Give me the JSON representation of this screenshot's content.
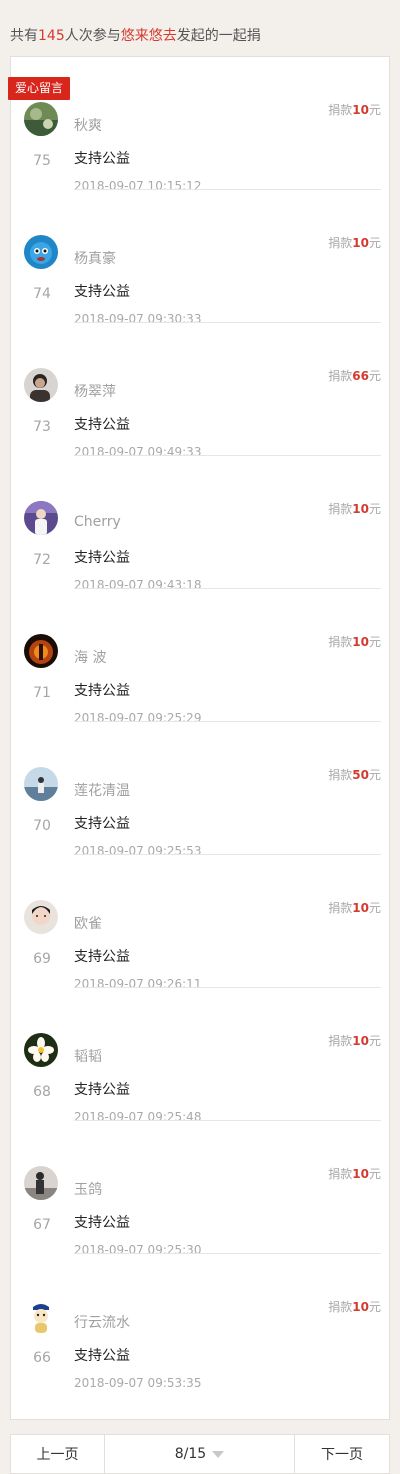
{
  "header": {
    "prefix": "共有",
    "count": "145",
    "middle": "人次参与",
    "initiator": "悠来悠去",
    "suffix": "发起的一起捐"
  },
  "badge": "爱心留言",
  "donation_prefix": "捐款",
  "currency_unit": "元",
  "accent_color": "#d53a2f",
  "items": [
    {
      "rank": "75",
      "name": "秋爽",
      "message": "支持公益",
      "time": "2018-09-07 10:15:12",
      "amount": "10",
      "avatar_icon": "lotus-pond-avatar-icon"
    },
    {
      "rank": "74",
      "name": "杨真豪",
      "message": "支持公益",
      "time": "2018-09-07 09:30:33",
      "amount": "10",
      "avatar_icon": "blue-cartoon-avatar-icon"
    },
    {
      "rank": "73",
      "name": "杨翠萍",
      "message": "支持公益",
      "time": "2018-09-07 09:49:33",
      "amount": "66",
      "avatar_icon": "person-portrait-avatar-icon"
    },
    {
      "rank": "72",
      "name": "Cherry",
      "message": "支持公益",
      "time": "2018-09-07 09:43:18",
      "amount": "10",
      "avatar_icon": "child-portrait-avatar-icon"
    },
    {
      "rank": "71",
      "name": "海 波",
      "message": "支持公益",
      "time": "2018-09-07 09:25:29",
      "amount": "10",
      "avatar_icon": "fire-figure-avatar-icon"
    },
    {
      "rank": "70",
      "name": "莲花清温",
      "message": "支持公益",
      "time": "2018-09-07 09:25:53",
      "amount": "50",
      "avatar_icon": "lakeside-person-avatar-icon"
    },
    {
      "rank": "69",
      "name": "欧雀",
      "message": "支持公益",
      "time": "2018-09-07 09:26:11",
      "amount": "10",
      "avatar_icon": "woman-portrait-avatar-icon"
    },
    {
      "rank": "68",
      "name": "韬韬",
      "message": "支持公益",
      "time": "2018-09-07 09:25:48",
      "amount": "10",
      "avatar_icon": "white-flower-avatar-icon"
    },
    {
      "rank": "67",
      "name": "玉鸽",
      "message": "支持公益",
      "time": "2018-09-07 09:25:30",
      "amount": "10",
      "avatar_icon": "standing-person-avatar-icon"
    },
    {
      "rank": "66",
      "name": "行云流水",
      "message": "支持公益",
      "time": "2018-09-07 09:53:35",
      "amount": "10",
      "avatar_icon": "cartoon-character-avatar-icon"
    }
  ],
  "pager": {
    "prev_label": "上一页",
    "page": "8/15",
    "next_label": "下一页"
  }
}
